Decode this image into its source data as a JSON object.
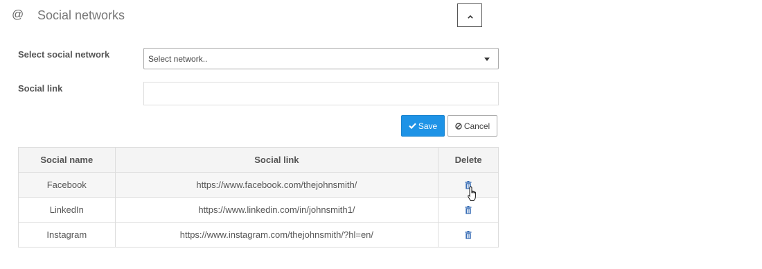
{
  "section": {
    "icon": "at-icon",
    "icon_char": "@",
    "title": "Social networks",
    "collapse_icon": "chevron-up-icon"
  },
  "form": {
    "network_label": "Select social network",
    "network_selected": "Select network..",
    "link_label": "Social link",
    "link_value": ""
  },
  "buttons": {
    "save_label": "Save",
    "save_icon": "check-icon",
    "cancel_label": "Cancel",
    "cancel_icon": "ban-icon",
    "save_color": "#1e93e6"
  },
  "table": {
    "headers": [
      "Social name",
      "Social link",
      "Delete"
    ],
    "delete_icon": "trash-icon",
    "rows": [
      {
        "name": "Facebook",
        "link": "https://www.facebook.com/thejohnsmith/"
      },
      {
        "name": "LinkedIn",
        "link": "https://www.linkedin.com/in/johnsmith1/"
      },
      {
        "name": "Instagram",
        "link": "https://www.instagram.com/thejohnsmith/?hl=en/"
      }
    ]
  },
  "colors": {
    "accent": "#1e93e6",
    "trash": "#3b6fb6"
  }
}
